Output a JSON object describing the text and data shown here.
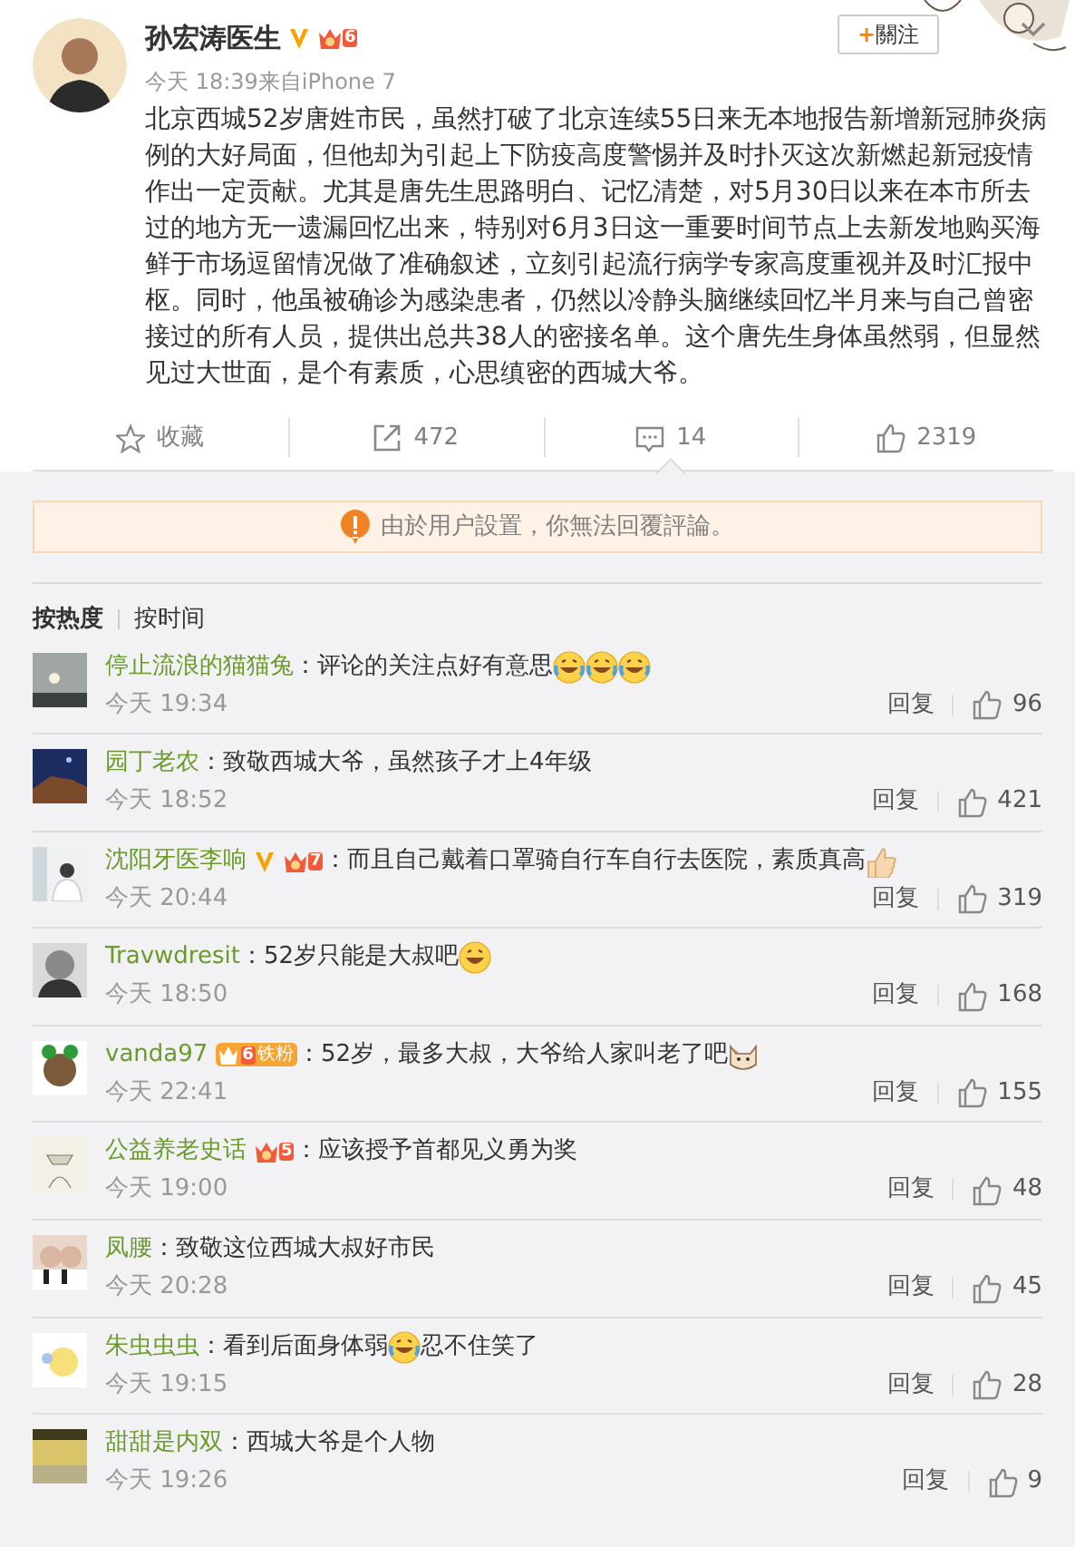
{
  "post": {
    "author": "孙宏涛医生",
    "badges": [
      {
        "kind": "verified"
      },
      {
        "kind": "rank",
        "rank": "6"
      }
    ],
    "time": "今天 18:39",
    "source": "来自iPhone 7",
    "follow_button": {
      "icon": "+",
      "label": "關注"
    },
    "text": "北京西城52岁唐姓市民，虽然打破了北京连续55日来无本地报告新增新冠肺炎病例的大好局面，但他却为引起上下防疫高度警惕并及时扑灭这次新燃起新冠疫情作出一定贡献。尤其是唐先生思路明白、记忆清楚，对5月30日以来在本市所去过的地方无一遗漏回忆出来，特别对6月3日这一重要时间节点上去新发地购买海鲜于市场逗留情况做了准确叙述，立刻引起流行病学专家高度重视并及时汇报中枢。同时，他虽被确诊为感染患者，仍然以冷静头脑继续回忆半月来与自己曾密接过的所有人员，提供出总共38人的密接名单。这个唐先生身体虽然弱，但显然见过大世面，是个有素质，心思缜密的西城大爷。"
  },
  "actions": [
    {
      "kind": "favorite",
      "label": "收藏",
      "selected": false
    },
    {
      "kind": "repost",
      "label": "472",
      "selected": false
    },
    {
      "kind": "comment",
      "label": "14",
      "selected": true
    },
    {
      "kind": "like",
      "label": "2319",
      "selected": false
    }
  ],
  "notice": "由於用户設置，你無法回覆評論。",
  "sort_tabs": [
    {
      "label": "按热度",
      "selected": true
    },
    {
      "label": "按时间",
      "selected": false
    }
  ],
  "comments": [
    {
      "user": "停止流浪的猫猫兔",
      "parts": [
        {
          "kind": "text",
          "text": "：评论的关注点好有意思"
        },
        {
          "kind": "laugh-cry"
        },
        {
          "kind": "laugh-cry"
        },
        {
          "kind": "laugh-cry"
        }
      ],
      "time": "今天 19:34",
      "reply": "回复",
      "likes": "96"
    },
    {
      "user": "园丁老农",
      "parts": [
        {
          "kind": "text",
          "text": "：致敬西城大爷，虽然孩子才上4年级"
        }
      ],
      "time": "今天 18:52",
      "reply": "回复",
      "likes": "421"
    },
    {
      "user": "沈阳牙医李响",
      "badges": [
        {
          "kind": "verified"
        },
        {
          "kind": "rank",
          "rank": "7"
        }
      ],
      "parts": [
        {
          "kind": "text",
          "text": "：而且自己戴着口罩骑自行车自行去医院，素质真高"
        },
        {
          "kind": "thumbs-up"
        }
      ],
      "time": "今天 20:44",
      "reply": "回复",
      "likes": "319"
    },
    {
      "user": "Travwdresit",
      "parts": [
        {
          "kind": "text",
          "text": "：52岁只能是大叔吧"
        },
        {
          "kind": "laugh"
        }
      ],
      "time": "今天 18:50",
      "reply": "回复",
      "likes": "168"
    },
    {
      "user": "vanda97",
      "badges": [
        {
          "kind": "fan",
          "rank": "6",
          "text": "铁粉"
        }
      ],
      "parts": [
        {
          "kind": "text",
          "text": "：52岁，最多大叔，大爷给人家叫老了吧"
        },
        {
          "kind": "cat"
        }
      ],
      "time": "今天 22:41",
      "reply": "回复",
      "likes": "155"
    },
    {
      "user": "公益养老史话",
      "badges": [
        {
          "kind": "rank",
          "rank": "5"
        }
      ],
      "parts": [
        {
          "kind": "text",
          "text": "：应该授予首都见义勇为奖"
        }
      ],
      "time": "今天 19:00",
      "reply": "回复",
      "likes": "48"
    },
    {
      "user": "凤腰",
      "parts": [
        {
          "kind": "text",
          "text": "：致敬这位西城大叔好市民"
        }
      ],
      "time": "今天 20:28",
      "reply": "回复",
      "likes": "45"
    },
    {
      "user": "朱虫虫虫",
      "parts": [
        {
          "kind": "text",
          "text": "：看到后面身体弱"
        },
        {
          "kind": "laugh-cry"
        },
        {
          "kind": "text",
          "text": "忍不住笑了"
        }
      ],
      "time": "今天 19:15",
      "reply": "回复",
      "likes": "28"
    },
    {
      "user": "甜甜是内双",
      "parts": [
        {
          "kind": "text",
          "text": "：西城大爷是个人物"
        }
      ],
      "time": "今天 19:26",
      "reply": "回复",
      "likes": "9"
    }
  ]
}
